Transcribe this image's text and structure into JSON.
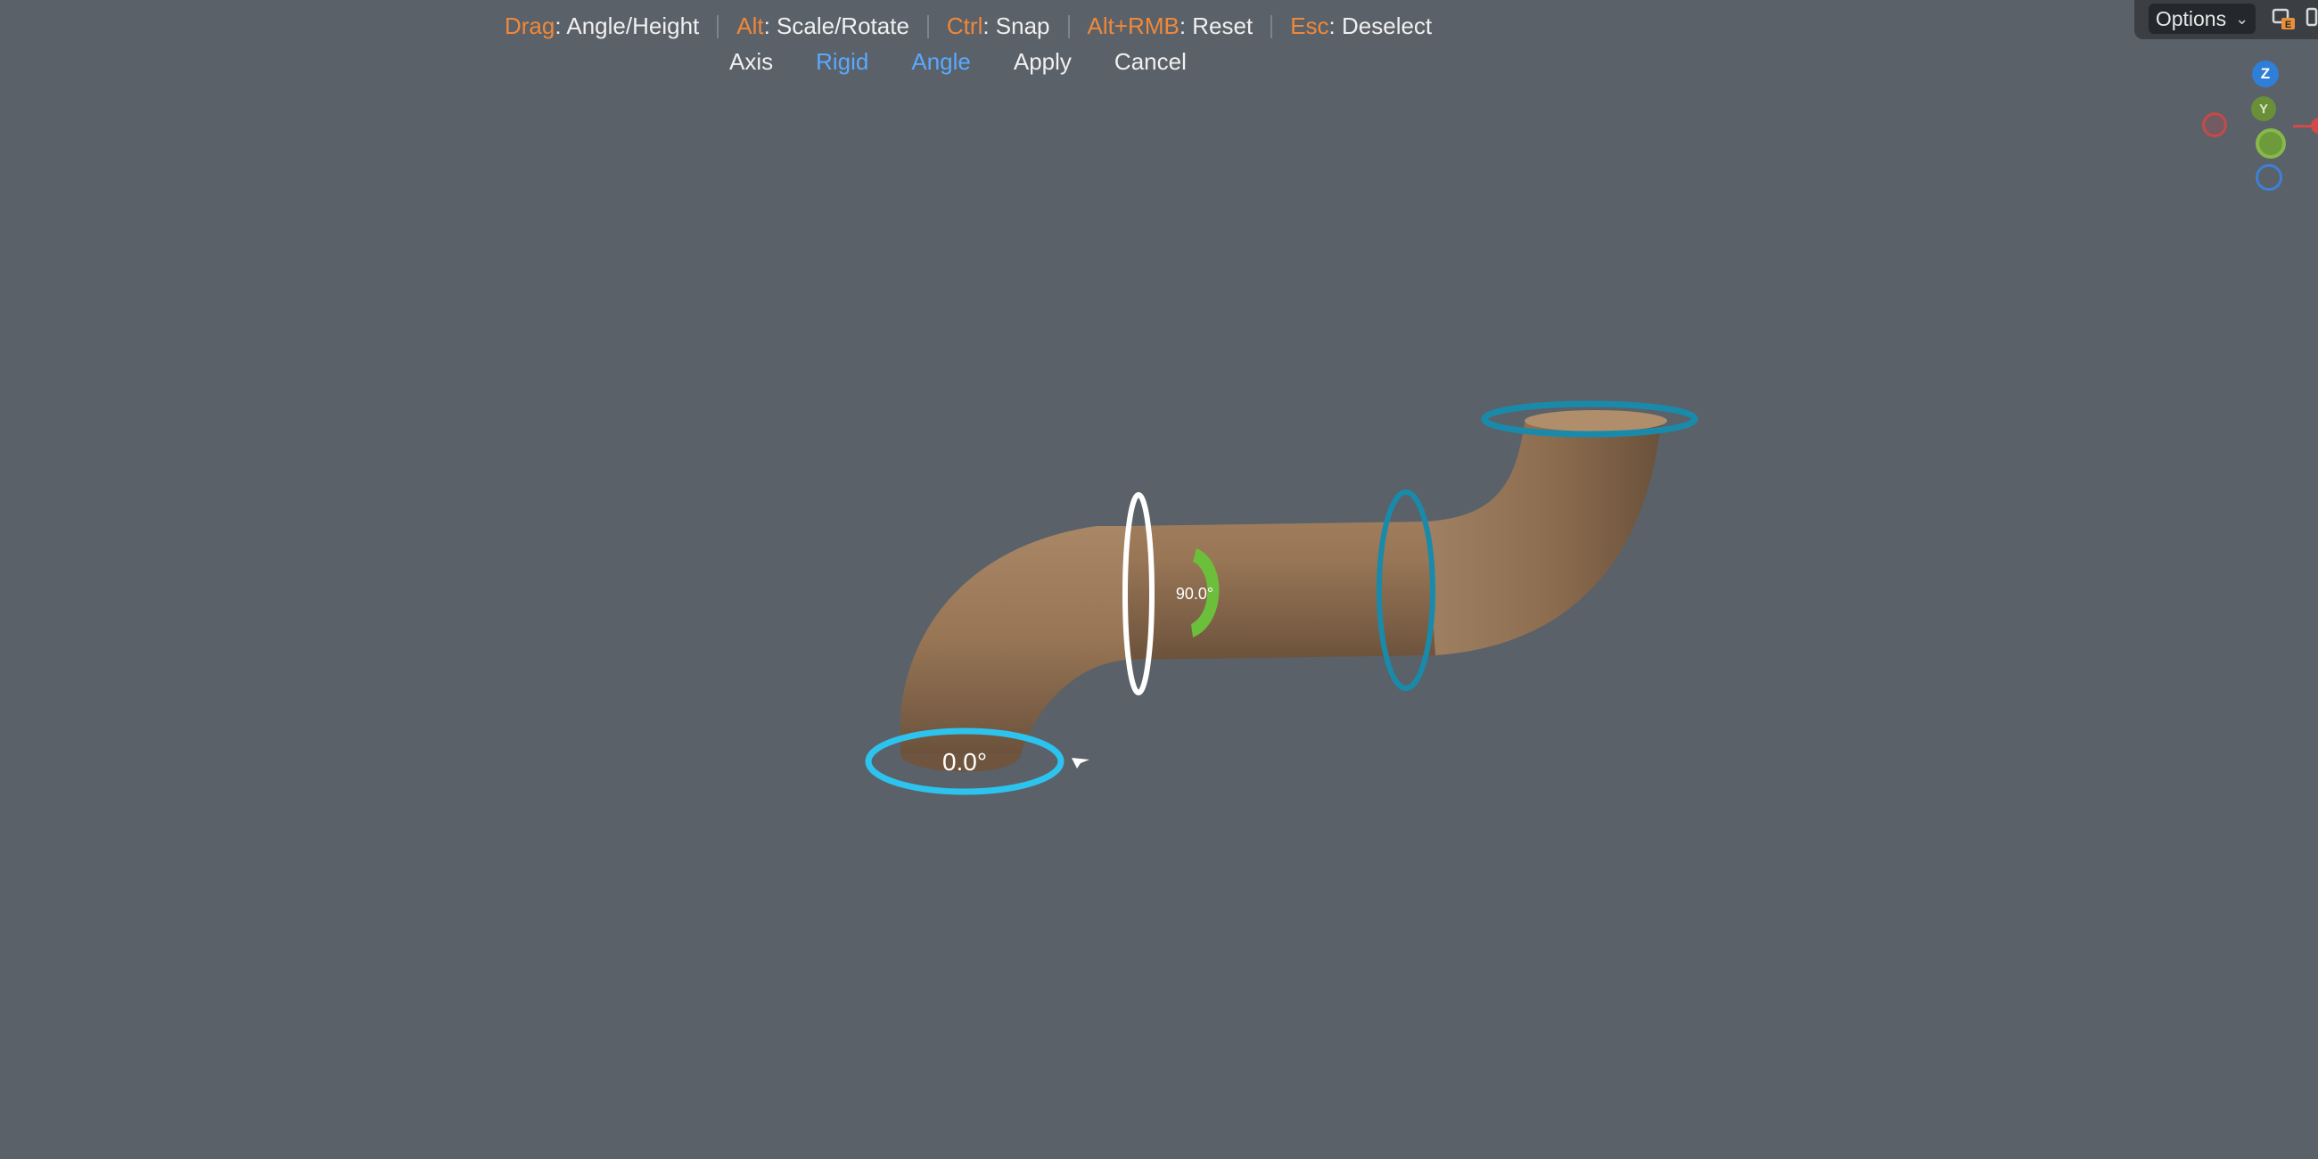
{
  "hints": [
    {
      "key": "Drag",
      "text": ": Angle/Height"
    },
    {
      "key": "Alt",
      "text": ": Scale/Rotate"
    },
    {
      "key": "Ctrl",
      "text": ": Snap"
    },
    {
      "key": "Alt+RMB",
      "text": ": Reset"
    },
    {
      "key": "Esc",
      "text": ": Deselect"
    }
  ],
  "tool_buttons": [
    {
      "label": "Axis",
      "active": false
    },
    {
      "label": "Rigid",
      "active": true
    },
    {
      "label": "Angle",
      "active": true
    },
    {
      "label": "Apply",
      "active": false
    },
    {
      "label": "Cancel",
      "active": false
    }
  ],
  "header": {
    "options_label": "Options",
    "options_icon": "chevron-down-icon",
    "tool_icon": "overlay-toggle-icon"
  },
  "navigation_gizmo": {
    "z_label": "Z",
    "y_label": "Y",
    "colors": {
      "x": "#d24a4a",
      "y": "#6a8f39",
      "z": "#2f7fd8"
    }
  },
  "viewport": {
    "bottom_angle_label": "0.0°",
    "bend_angle_label": "90.0°",
    "colors": {
      "pipe": "#9a7a5a",
      "active_ring": "#2cc4ee",
      "ring": "#1a8aaa",
      "selected_ring": "#ffffff",
      "angle_gizmo": "#6bbf3a"
    }
  }
}
